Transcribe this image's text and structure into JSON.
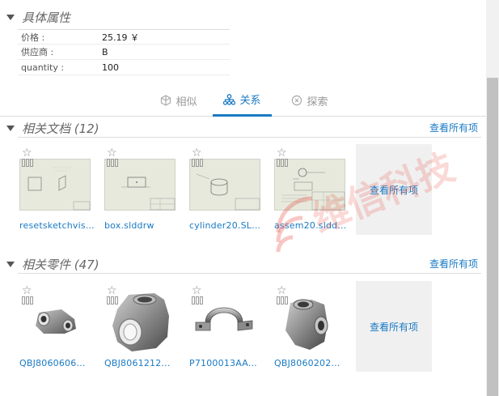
{
  "attributes": {
    "title": "具体属性",
    "rows": [
      {
        "key": "价格 :",
        "value": "25.19 ￥"
      },
      {
        "key": "供应商 :",
        "value": "B"
      },
      {
        "key": "quantity :",
        "value": "100"
      }
    ]
  },
  "tabs": [
    {
      "label": "相似",
      "icon": "cube-icon",
      "active": false
    },
    {
      "label": "关系",
      "icon": "hierarchy-icon",
      "active": true
    },
    {
      "label": "探索",
      "icon": "explore-icon",
      "active": false
    }
  ],
  "documents": {
    "title": "相关文档 (12)",
    "see_all_link": "查看所有项",
    "see_all_box": "查看所有项",
    "items": [
      {
        "caption": "resetsketchvis..."
      },
      {
        "caption": "box.slddrw"
      },
      {
        "caption": "cylinder20.SL..."
      },
      {
        "caption": "assem20.sldd..."
      }
    ]
  },
  "parts": {
    "title": "相关零件 (47)",
    "see_all_link": "查看所有项",
    "see_all_box": "查看所有项",
    "items": [
      {
        "caption": "QBJ8060606..."
      },
      {
        "caption": "QBJ8061212..."
      },
      {
        "caption": "P7100013AA..."
      },
      {
        "caption": "QBJ8060202..."
      }
    ]
  },
  "watermark": {
    "text": "维信科技"
  },
  "colors": {
    "accent": "#1a7ac4",
    "watermark": "#e8473a"
  }
}
